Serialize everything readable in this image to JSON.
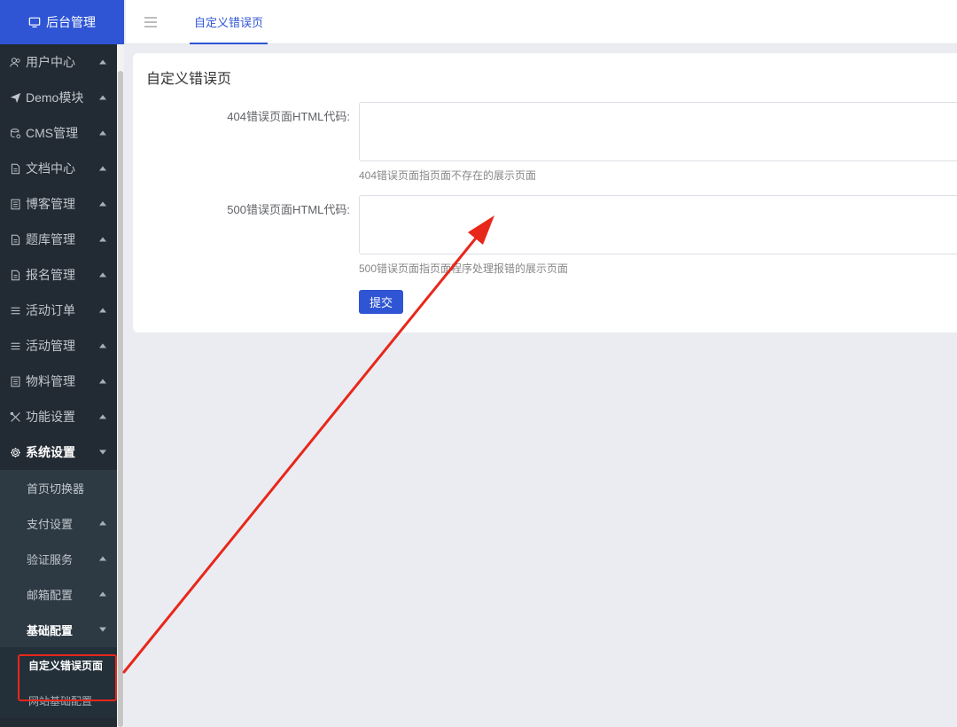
{
  "sidebar": {
    "brand": "后台管理",
    "menu": [
      {
        "label": "用户中心",
        "icon": "users-icon",
        "caret": "up"
      },
      {
        "label": "Demo模块",
        "icon": "send-icon",
        "caret": "up"
      },
      {
        "label": "CMS管理",
        "icon": "database-icon",
        "caret": "up"
      },
      {
        "label": "文档中心",
        "icon": "document-icon",
        "caret": "up"
      },
      {
        "label": "博客管理",
        "icon": "list-doc-icon",
        "caret": "up"
      },
      {
        "label": "题库管理",
        "icon": "document-icon",
        "caret": "up"
      },
      {
        "label": "报名管理",
        "icon": "document-icon",
        "caret": "up"
      },
      {
        "label": "活动订单",
        "icon": "lines-icon",
        "caret": "up"
      },
      {
        "label": "活动管理",
        "icon": "lines-icon",
        "caret": "up"
      },
      {
        "label": "物料管理",
        "icon": "list-doc-icon",
        "caret": "up"
      },
      {
        "label": "功能设置",
        "icon": "tools-icon",
        "caret": "up"
      }
    ],
    "open_menu": {
      "label": "系统设置",
      "icon": "gear-icon",
      "caret": "down"
    },
    "submenu": [
      {
        "label": "首页切换器"
      },
      {
        "label": "支付设置"
      },
      {
        "label": "验证服务"
      },
      {
        "label": "邮箱配置"
      }
    ],
    "open_submenu": {
      "label": "基础配置"
    },
    "third": [
      {
        "label": "自定义错误页面",
        "active": true
      },
      {
        "label": "网站基础配置",
        "active": false
      }
    ]
  },
  "topbar": {
    "active_tab": "自定义错误页"
  },
  "card": {
    "title": "自定义错误页",
    "field404": {
      "label": "404错误页面HTML代码:",
      "value": "",
      "hint": "404错误页面指页面不存在的展示页面"
    },
    "field500": {
      "label": "500错误页面HTML代码:",
      "value": "",
      "hint": "500错误页面指页面程序处理报错的展示页面"
    },
    "submit_label": "提交"
  },
  "colors": {
    "brand": "#2f55d4",
    "sidebar_bg": "#222b33",
    "annotation": "#e8271b"
  }
}
